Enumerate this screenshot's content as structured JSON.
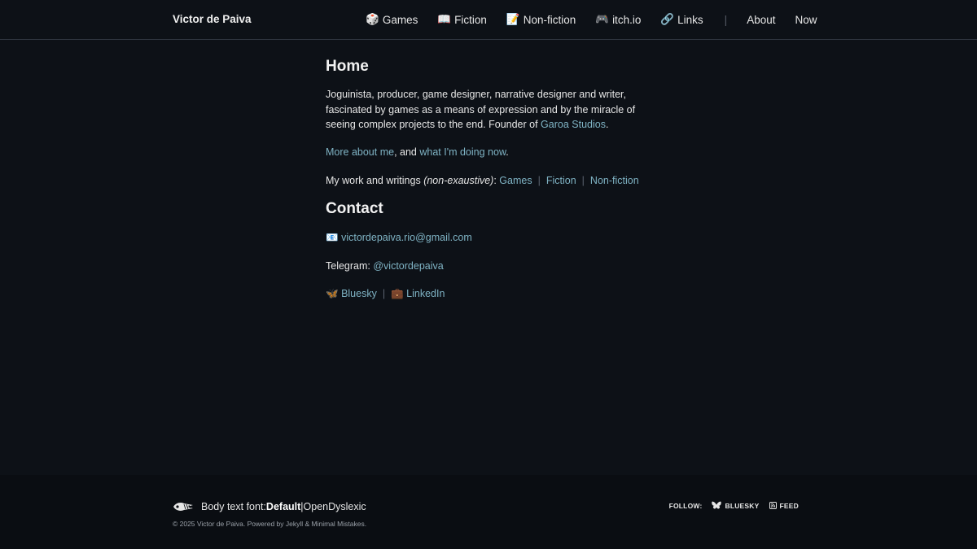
{
  "header": {
    "site_title": "Victor de Paiva",
    "nav": [
      {
        "icon": "🎲",
        "label": "Games"
      },
      {
        "icon": "📖",
        "label": "Fiction"
      },
      {
        "icon": "📝",
        "label": "Non-fiction"
      },
      {
        "icon": "🎮",
        "label": "itch.io"
      },
      {
        "icon": "🔗",
        "label": "Links"
      }
    ],
    "separator": "|",
    "nav_plain": [
      "About",
      "Now"
    ]
  },
  "home": {
    "title": "Home",
    "intro_text": "Joguinista, producer, game designer, narrative designer and writer, fascinated by games as a means of expression and by the miracle of seeing complex projects to the end. Founder of ",
    "intro_link": "Garoa Studios",
    "intro_end": ".",
    "more_link_1": "More about me",
    "more_mid": ", and ",
    "more_link_2": "what I'm doing now",
    "more_end": ".",
    "work_prefix": "My work and writings ",
    "work_em": "(non-exaustive)",
    "work_colon": ": ",
    "work_links": [
      "Games",
      "Fiction",
      "Non-fiction"
    ],
    "pipe": "|"
  },
  "contact": {
    "title": "Contact",
    "email_icon": "📧",
    "email": "victordepaiva.rio@gmail.com",
    "telegram_label": "Telegram: ",
    "telegram_handle": "@victordepaiva",
    "bluesky_icon": "🦋",
    "bluesky": "Bluesky",
    "linkedin_icon": "💼",
    "linkedin": "LinkedIn"
  },
  "footer": {
    "font_label": "Body text font: ",
    "font_default": "Default",
    "font_sep": " | ",
    "font_alt": "OpenDyslexic",
    "copyright": "© 2025 Victor de Paiva. Powered by Jekyll & Minimal Mistakes.",
    "follow_label": "FOLLOW:",
    "follow_bluesky": "BLUESKY",
    "follow_feed": "FEED"
  }
}
